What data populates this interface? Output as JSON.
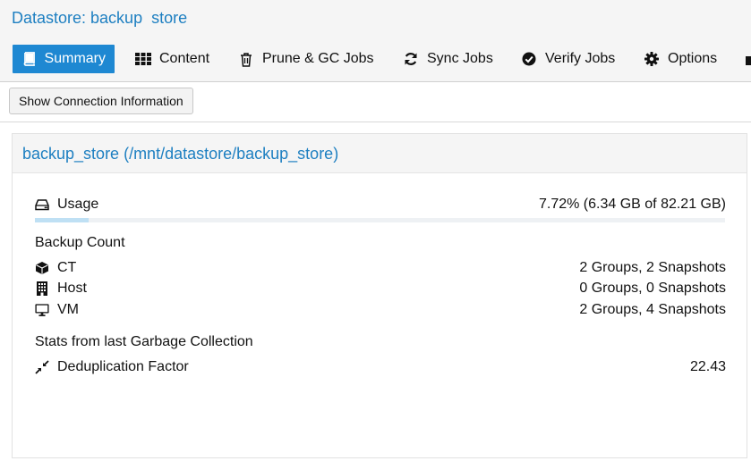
{
  "header": {
    "title": "Datastore: backup  store",
    "tabs": [
      {
        "label": "Summary",
        "icon": "book-icon",
        "active": true
      },
      {
        "label": "Content",
        "icon": "grid-icon",
        "active": false
      },
      {
        "label": "Prune & GC Jobs",
        "icon": "trash-icon",
        "active": false
      },
      {
        "label": "Sync Jobs",
        "icon": "sync-icon",
        "active": false
      },
      {
        "label": "Verify Jobs",
        "icon": "check-circle-icon",
        "active": false
      },
      {
        "label": "Options",
        "icon": "gear-icon",
        "active": false
      }
    ],
    "accent_color": "#1e88d2",
    "title_color": "#1d7fc1"
  },
  "toolbar": {
    "show_connection_label": "Show Connection Information"
  },
  "panel": {
    "title": "backup_store (/mnt/datastore/backup_store)",
    "usage": {
      "label": "Usage",
      "icon": "hdd-icon",
      "value_text": "7.72% (6.34 GB of 82.21 GB)",
      "fraction": 0.0772
    },
    "backup_count": {
      "heading": "Backup Count",
      "rows": [
        {
          "label": "CT",
          "icon": "cube-icon",
          "value": "2 Groups, 2 Snapshots"
        },
        {
          "label": "Host",
          "icon": "building-icon",
          "value": "0 Groups, 0 Snapshots"
        },
        {
          "label": "VM",
          "icon": "desktop-icon",
          "value": "2 Groups, 4 Snapshots"
        }
      ]
    },
    "gc_stats": {
      "heading": "Stats from last Garbage Collection",
      "rows": [
        {
          "label": "Deduplication Factor",
          "icon": "compress-icon",
          "value": "22.43"
        }
      ]
    }
  }
}
